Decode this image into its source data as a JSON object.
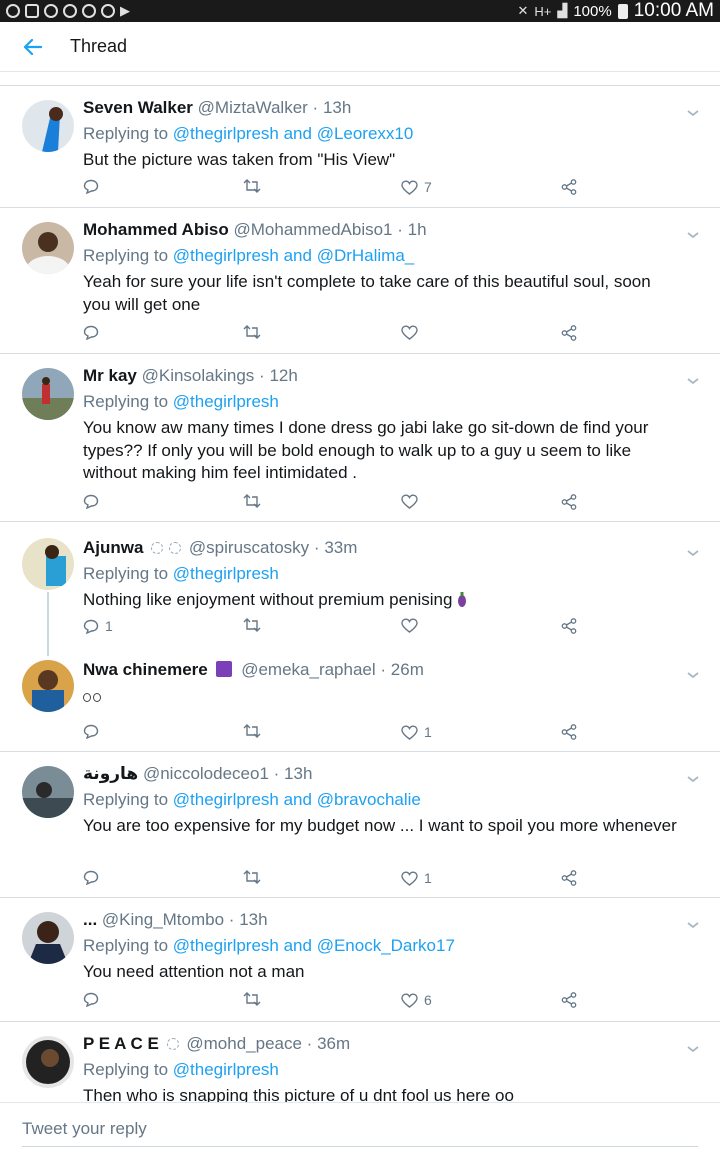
{
  "status_bar": {
    "battery": "100%",
    "time": "10:00 AM",
    "network": "H+"
  },
  "app_bar": {
    "title": "Thread"
  },
  "tweets": [
    {
      "name": "Seven Walker",
      "handle": "@MiztaWalker",
      "sep": "·",
      "time": "13h",
      "replying_prefix": "Replying to",
      "replying_to": "@thegirlpresh and @Leorexx10",
      "text": "But the picture was taken from \"His View\"",
      "replies": "",
      "likes": "7"
    },
    {
      "name": "Mohammed Abiso",
      "handle": "@MohammedAbiso1",
      "sep": "·",
      "time": "1h",
      "replying_prefix": "Replying to",
      "replying_to": "@thegirlpresh and @DrHalima_",
      "text": "Yeah for sure your life isn't complete to take care of this beautiful soul, soon you will get one",
      "replies": "",
      "likes": ""
    },
    {
      "name": "Mr kay",
      "handle": "@Kinsolakings",
      "sep": "·",
      "time": "12h",
      "replying_prefix": "Replying to",
      "replying_to": "@thegirlpresh",
      "text": "You know aw many times I done dress go jabi lake go sit-down de find your types?? If only you will be bold enough to walk up to a guy u seem to like without making him feel intimidated  .",
      "replies": "",
      "likes": ""
    },
    {
      "name": "Ajunwa",
      "handle": "@spiruscatosky",
      "sep": "·",
      "time": "33m",
      "replying_prefix": "Replying to",
      "replying_to": "@thegirlpresh",
      "text": "Nothing like enjoyment without premium penising",
      "replies": "1",
      "likes": ""
    },
    {
      "name": "Nwa chinemere",
      "handle": "@emeka_raphael",
      "sep": "·",
      "time": "26m",
      "replying_prefix": "",
      "replying_to": "",
      "text": "",
      "replies": "",
      "likes": "1"
    },
    {
      "name": "هارونة",
      "handle": "@niccolodeceo1",
      "sep": "·",
      "time": "13h",
      "replying_prefix": "Replying to",
      "replying_to": "@thegirlpresh and @bravochalie",
      "text": "You are too expensive for my budget now   ... I want to spoil you more whenever",
      "replies": "",
      "likes": "1"
    },
    {
      "name": "...",
      "handle": "@King_Mtombo",
      "sep": "·",
      "time": "13h",
      "replying_prefix": "Replying to",
      "replying_to": "@thegirlpresh and @Enock_Darko17",
      "text": "You need attention not a man",
      "replies": "",
      "likes": "6"
    },
    {
      "name": "P E A C E",
      "handle": "@mohd_peace",
      "sep": "·",
      "time": "36m",
      "replying_prefix": "Replying to",
      "replying_to": "@thegirlpresh",
      "text": "Then who is snapping this picture of u  dnt fool us here oo",
      "replies": "",
      "likes": ""
    }
  ],
  "compose": {
    "placeholder": "Tweet your reply"
  },
  "colors": {
    "accent": "#1da1f2",
    "secondary_text": "#657786",
    "divider": "#d8dde1"
  }
}
